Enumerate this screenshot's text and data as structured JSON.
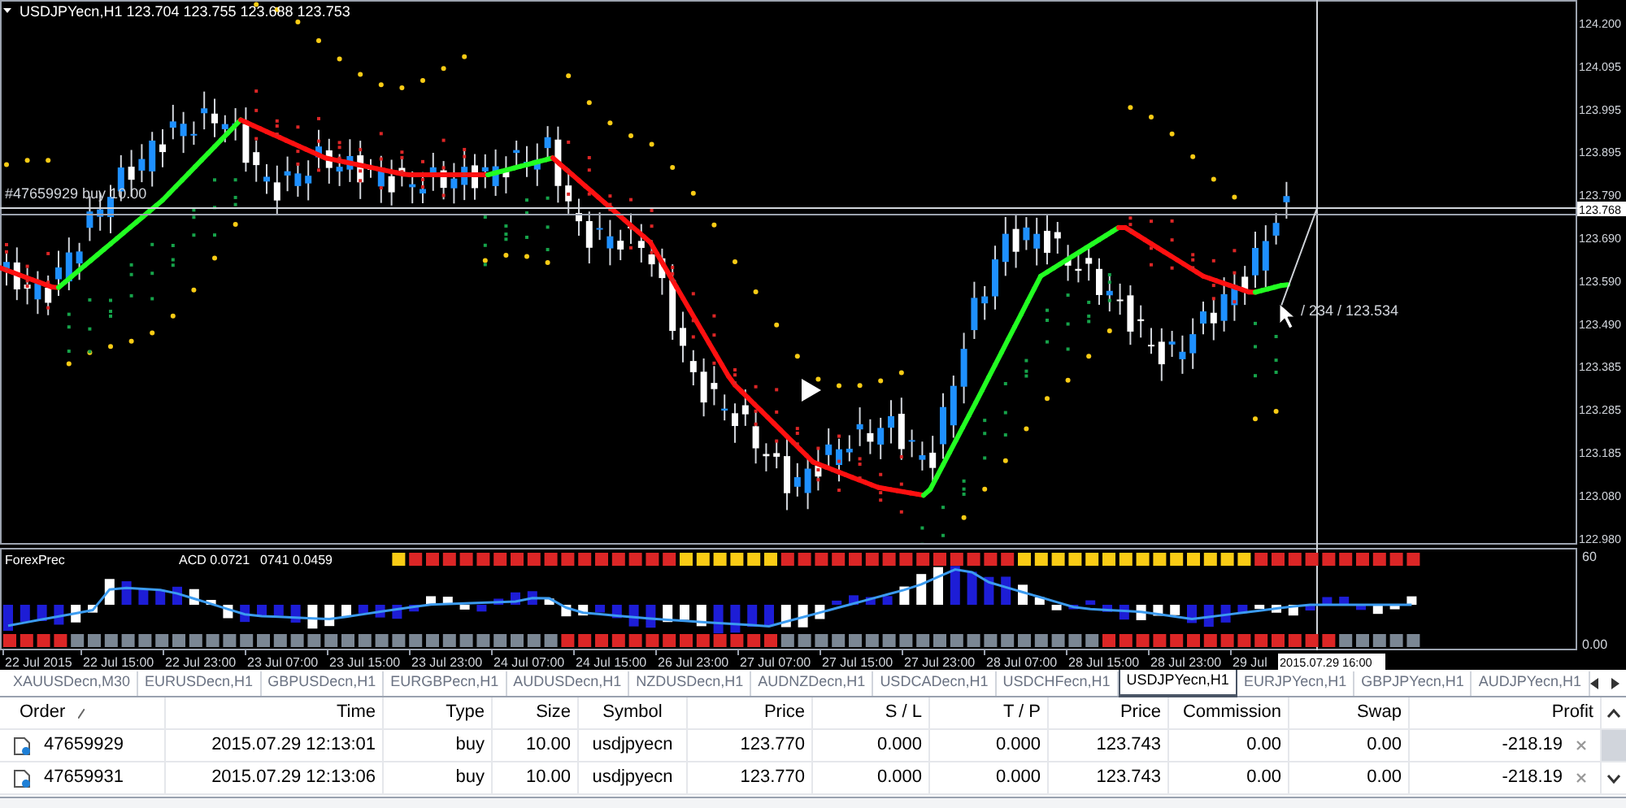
{
  "chart": {
    "symbol_line": "USDJPYecn,H1  123.704 123.755 123.688 123.753",
    "order_label": "#47659929 buy 10.00",
    "crosshair_readout": "/ 234 / 123.534",
    "price_axis": [
      "124.200",
      "124.095",
      "123.995",
      "123.895",
      "123.790",
      "123.690",
      "123.590",
      "123.490",
      "123.385",
      "123.285",
      "123.185",
      "123.080",
      "122.980"
    ],
    "current_price": "123.768"
  },
  "indicator": {
    "label_parts": [
      "ForexPrec",
      "ACD 0.0721",
      "0741 0.0459"
    ],
    "scale": [
      "60",
      "0.00"
    ]
  },
  "time_axis": {
    "labels": [
      "22 Jul 2015",
      "22 Jul 15:00",
      "22 Jul 23:00",
      "23 Jul 07:00",
      "23 Jul 15:00",
      "23 Jul 23:00",
      "24 Jul 07:00",
      "24 Jul 15:00",
      "26 Jul 23:00",
      "27 Jul 07:00",
      "27 Jul 15:00",
      "27 Jul 23:00",
      "28 Jul 07:00",
      "28 Jul 15:00",
      "28 Jul 23:00",
      "29 Jul"
    ],
    "cursor_time": "2015.07.29 16:00"
  },
  "symbol_tabs": [
    {
      "label": "XAUUSDecn,M30",
      "selected": false
    },
    {
      "label": "EURUSDecn,H1",
      "selected": false
    },
    {
      "label": "GBPUSDecn,H1",
      "selected": false
    },
    {
      "label": "EURGBPecn,H1",
      "selected": false
    },
    {
      "label": "AUDUSDecn,H1",
      "selected": false
    },
    {
      "label": "NZDUSDecn,H1",
      "selected": false
    },
    {
      "label": "AUDNZDecn,H1",
      "selected": false
    },
    {
      "label": "USDCADecn,H1",
      "selected": false
    },
    {
      "label": "USDCHFecn,H1",
      "selected": false
    },
    {
      "label": "USDJPYecn,H1",
      "selected": true
    },
    {
      "label": "EURJPYecn,H1",
      "selected": false
    },
    {
      "label": "GBPJPYecn,H1",
      "selected": false
    },
    {
      "label": "AUDJPYecn,H1",
      "selected": false
    }
  ],
  "trades": {
    "columns": [
      "Order",
      "Time",
      "Type",
      "Size",
      "Symbol",
      "Price",
      "S / L",
      "T / P",
      "Price",
      "Commission",
      "Swap",
      "Profit"
    ],
    "rows": [
      {
        "cells": [
          "47659929",
          "2015.07.29 12:13:01",
          "buy",
          "10.00",
          "usdjpyecn",
          "123.770",
          "0.000",
          "0.000",
          "123.743",
          "0.00",
          "0.00",
          "-218.19"
        ]
      },
      {
        "cells": [
          "47659931",
          "2015.07.29 12:13:06",
          "buy",
          "10.00",
          "usdjpyecn",
          "123.770",
          "0.000",
          "0.000",
          "123.743",
          "0.00",
          "0.00",
          "-218.19"
        ]
      }
    ]
  }
}
